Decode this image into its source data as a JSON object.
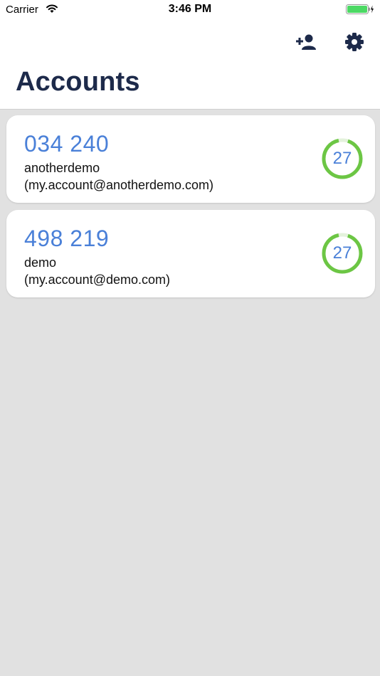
{
  "status_bar": {
    "carrier": "Carrier",
    "time": "3:46 PM"
  },
  "header": {
    "title": "Accounts",
    "icons": {
      "add": "add-person-icon",
      "settings": "gear-icon"
    }
  },
  "accounts": [
    {
      "code": "034 240",
      "name": "anotherdemo",
      "email": "(my.account@anotherdemo.com)",
      "seconds_left": "27"
    },
    {
      "code": "498 219",
      "name": "demo",
      "email": "(my.account@demo.com)",
      "seconds_left": "27"
    }
  ],
  "colors": {
    "code": "#4a80d8",
    "title": "#1d2a4a",
    "timer_ring": "#6cc644",
    "background": "#e1e1e1",
    "battery": "#4cd964"
  }
}
